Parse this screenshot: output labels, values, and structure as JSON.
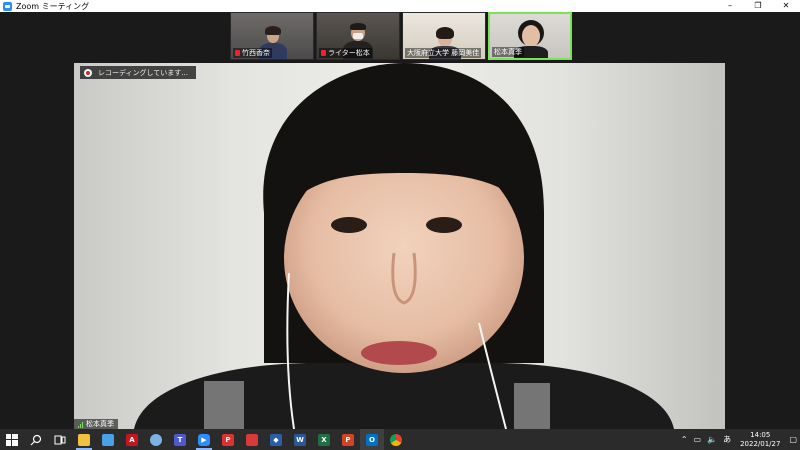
{
  "window": {
    "title": "Zoom ミーティング",
    "minimize": "–",
    "maximize": "❐",
    "close": "✕"
  },
  "thumbnails": [
    {
      "name": "竹西香奈",
      "muted": true
    },
    {
      "name": "ライター松本",
      "muted": true
    },
    {
      "name": "大阪府立大学 藤岡美佳",
      "muted": false
    },
    {
      "name": "松本真季",
      "muted": false
    }
  ],
  "recording": {
    "text": "レコーディングしています..."
  },
  "speaker": {
    "name": "松本真季"
  },
  "taskbar": {
    "apps": [
      "windows-start",
      "search",
      "task-view",
      "file-explorer",
      "store",
      "acrobat",
      "browser",
      "teams",
      "zoom",
      "pdf",
      "reader",
      "app-blue",
      "word",
      "excel",
      "powerpoint",
      "outlook",
      "chrome"
    ],
    "ime": "あ",
    "time": "14:05",
    "date": "2022/01/27",
    "notif": "20"
  }
}
